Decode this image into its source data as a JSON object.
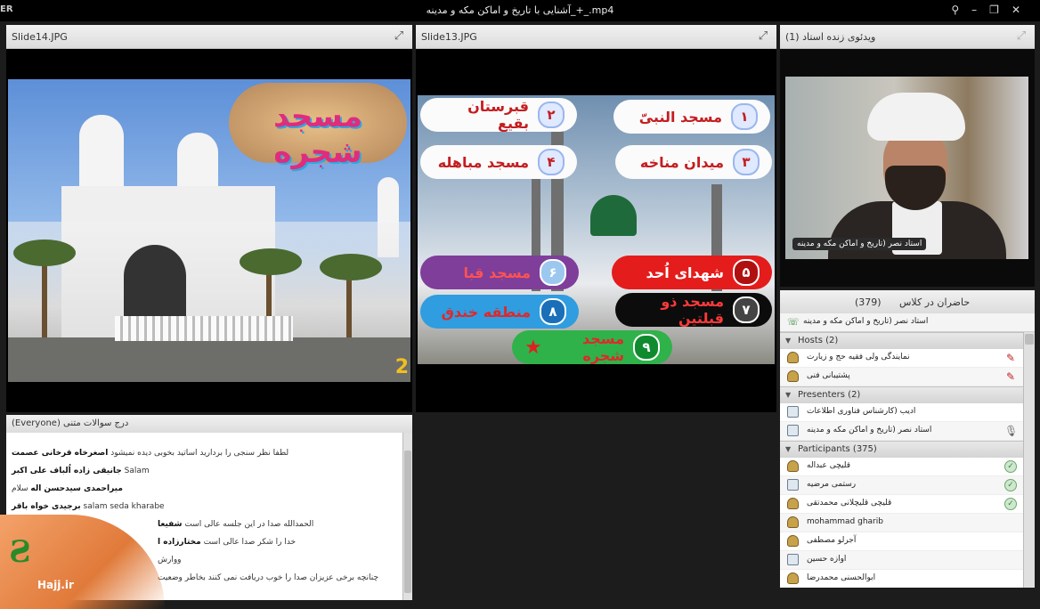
{
  "titlebar": {
    "left_label": "ER",
    "title": "آشنایی با تاریخ و اماکن مکه و مدینه_+_.mp4",
    "icons": [
      "pin-icon",
      "minimize-icon",
      "restore-icon",
      "close-icon"
    ]
  },
  "slide14": {
    "title": "Slide14.JPG",
    "heading": "مسجد شجره",
    "corner_number": "2"
  },
  "slide13": {
    "title": "Slide13.JPG",
    "items": [
      {
        "num": "۱",
        "label": "مسجد النبیّ"
      },
      {
        "num": "۲",
        "label": "قبرستان بقیع"
      },
      {
        "num": "۳",
        "label": "میدان مناخه"
      },
      {
        "num": "۴",
        "label": "مسجد مباهله"
      },
      {
        "num": "۵",
        "label": "شهدای اُحد"
      },
      {
        "num": "۶",
        "label": "مسجد قبا"
      },
      {
        "num": "۷",
        "label": "مسجد ذو قبلتین"
      },
      {
        "num": "۸",
        "label": "منطقه خندق"
      },
      {
        "num": "۹",
        "label": "مسجد شجره"
      }
    ]
  },
  "video": {
    "title": "ویدئوی زنده استاد  (1)",
    "caption": "استاد نصر (تاریخ و اماکن مکه و مدینه"
  },
  "chat": {
    "title": "درج سوالات متنی  (Everyone)",
    "lines": [
      {
        "sender": "",
        "text": "لطفا نظر سنجی را بردارید اساتید بخوبی دیده نمیشود",
        "name": "اصغرخاه قرخانی عصمت"
      },
      {
        "sender": "جانیقی زاده اُلباف علی اکبر",
        "text": "Salam"
      },
      {
        "sender": "میراحمدی سیدحسن اله",
        "text": "سلام"
      },
      {
        "sender": "برجیدی خواه باقر",
        "text": "salam seda kharabe"
      },
      {
        "sender": "",
        "text": "الحمدالله صدا در این جلسه عالی است",
        "name": "شفیعا"
      },
      {
        "sender": "",
        "text": "خدا را شکر صدا عالی است",
        "name": "مختارزاده ا"
      },
      {
        "sender": "",
        "text": "ووارش"
      },
      {
        "sender": "",
        "text": "چنانچه برخی عزیزان صدا را خوب دریافت نمی کنند بخاطر وضعیت"
      }
    ]
  },
  "attendees": {
    "title": "حاضران در کلاس",
    "count": "(379)",
    "speaker": "استاد نصر (تاریخ و اماکن مکه و مدینه",
    "hosts_label": "Hosts (2)",
    "hosts": [
      "نمایندگی ولی فقیه حج و زیارت",
      "پشتیبانی فنی"
    ],
    "presenters_label": "Presenters (2)",
    "presenters": [
      "ادیب (کارشناس فناوری اطلاعات",
      "استاد نصر (تاریخ و اماکن مکه و مدینه"
    ],
    "participants_label": "Participants (375)",
    "participants": [
      "قلیچی عبداله",
      "رستمی مرضیه",
      "قلیچی قلیچلانی محمدتقی",
      "mohammad gharib",
      "آجرلو مصطفی",
      "اوازه حسین",
      "ابوالحسنی محمدرضا"
    ]
  },
  "logo": {
    "text": "Hajj.ir"
  },
  "colors": {
    "active_border": "#39b54a",
    "pill_red": "#e41c1c",
    "pill_purple": "#7e3e9a",
    "pill_blue": "#2f9de0",
    "pill_green": "#2fb24a"
  }
}
